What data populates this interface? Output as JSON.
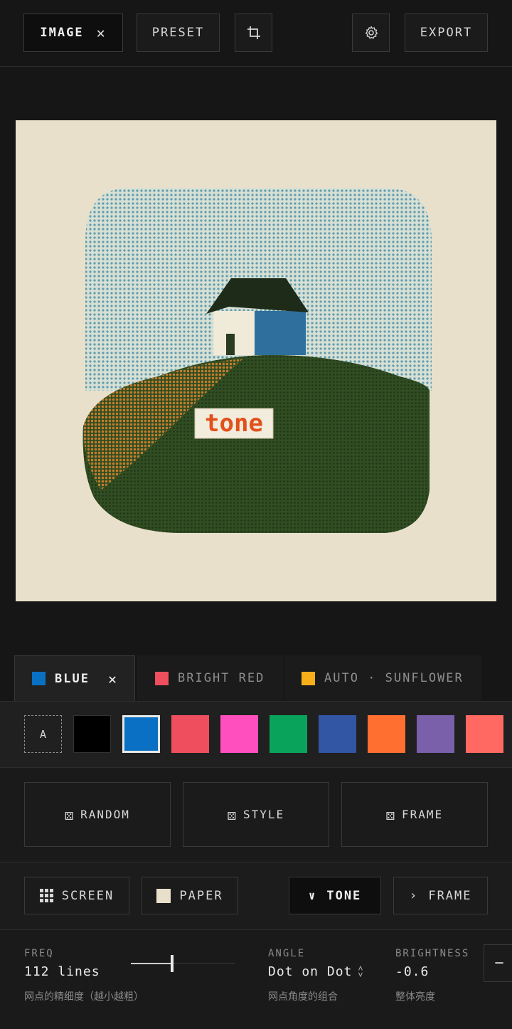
{
  "toolbar": {
    "image_label": "IMAGE",
    "preset_label": "PRESET",
    "export_label": "EXPORT"
  },
  "canvas": {
    "overlay_text": "tone"
  },
  "color_tabs": [
    {
      "label": "BLUE",
      "color": "#0a70c4",
      "active": true
    },
    {
      "label": "BRIGHT RED",
      "color": "#ee4e5d",
      "active": false
    },
    {
      "label": "AUTO · SUNFLOWER",
      "color": "#f7b01a",
      "active": false
    }
  ],
  "palette": {
    "auto_label": "A",
    "colors": [
      "#000000",
      "#0a70c4",
      "#ee4e5d",
      "#ff4fbf",
      "#0aa35c",
      "#3255a4",
      "#ff6f2f",
      "#7a5fab",
      "#ff6962"
    ]
  },
  "actions": {
    "random_label": "RANDOM",
    "style_label": "STYLE",
    "frame_label": "FRAME"
  },
  "modes": {
    "screen_label": "SCREEN",
    "paper_label": "PAPER",
    "tone_label": "TONE",
    "frame_label": "FRAME"
  },
  "params": {
    "freq": {
      "label": "FREQ",
      "value": "112 lines",
      "hint": "网点的精细度（越小越粗）",
      "slider_fraction": 0.4
    },
    "angle": {
      "label": "ANGLE",
      "value": "Dot on Dot",
      "hint": "网点角度的组合"
    },
    "brightness": {
      "label": "BRIGHTNESS",
      "value": "-0.6",
      "hint": "整体亮度"
    },
    "minus_label": "−"
  }
}
